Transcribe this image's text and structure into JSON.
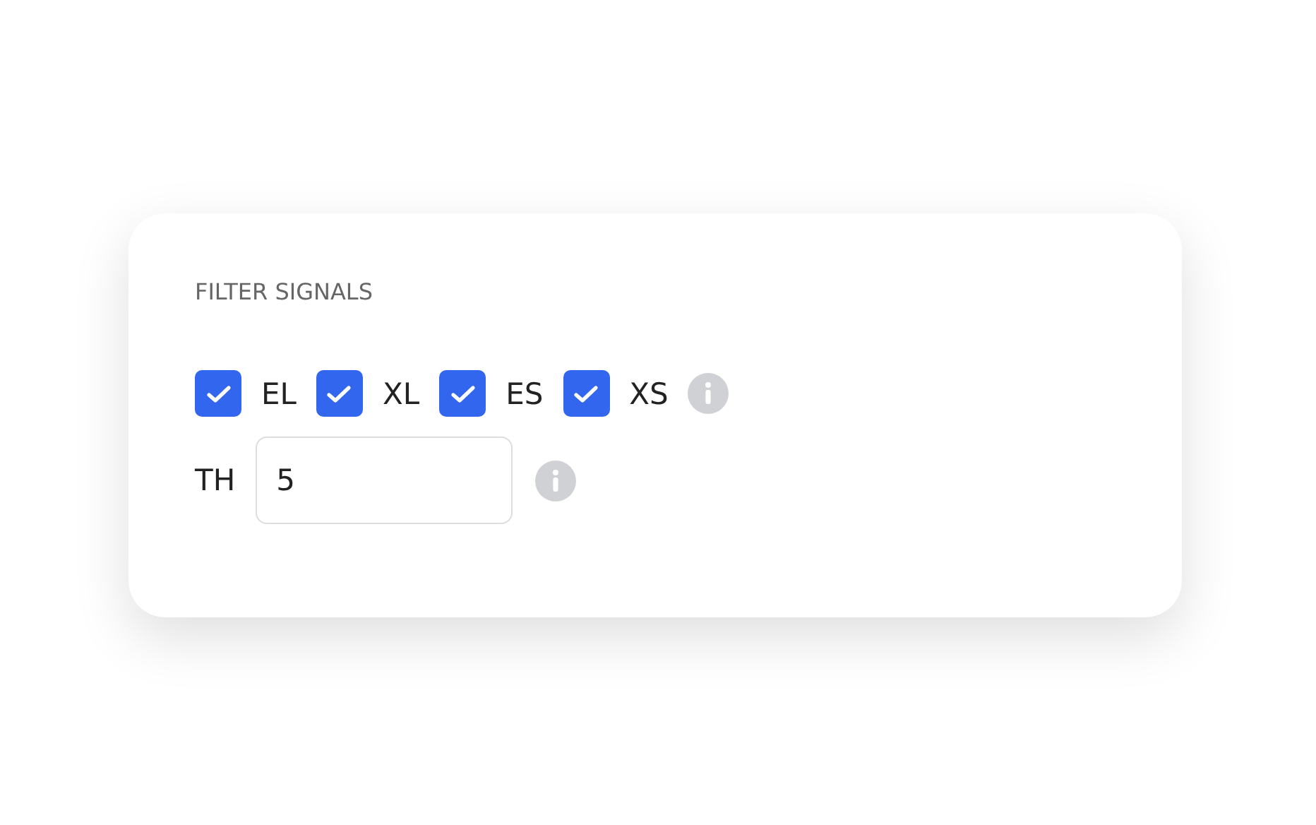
{
  "panel": {
    "title": "FILTER SIGNALS",
    "signals": [
      {
        "label": "EL",
        "checked": true
      },
      {
        "label": "XL",
        "checked": true
      },
      {
        "label": "ES",
        "checked": true
      },
      {
        "label": "XS",
        "checked": true
      }
    ],
    "threshold": {
      "label": "TH",
      "value": "5"
    }
  }
}
